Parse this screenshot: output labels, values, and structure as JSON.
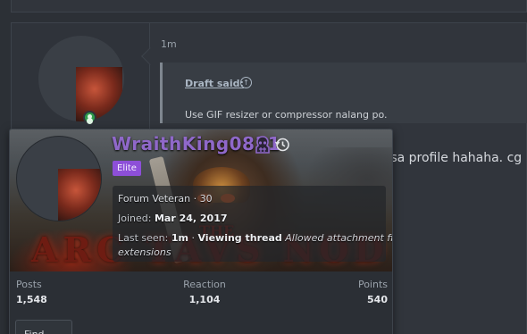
{
  "post": {
    "time": "1m",
    "quote_author": "Draft said:",
    "quote_arrow_icon": "arrow-up-icon",
    "quote_text": "Use GIF resizer or compressor nalang po.",
    "body_text": "n sa profile hahaha. cg"
  },
  "member_card": {
    "username": "WraithKing0831",
    "username_color": "#8f68c9",
    "staff_icon": "staff-badge-icon",
    "history_icon": "history-icon",
    "banner_label": "Elite",
    "banner_color": "#8d4fd8",
    "title_line": "Forum Veteran · 30",
    "joined_label": "Joined:",
    "joined_value": "Mar 24, 2017",
    "last_seen_label": "Last seen:",
    "last_seen_time": "1m",
    "last_seen_separator": " · ",
    "activity": "Viewing thread",
    "activity_detail_1": "Allowed attachment file",
    "activity_detail_2": "extensions",
    "stats": [
      {
        "label": "Posts",
        "value": "1,548"
      },
      {
        "label": "Reaction",
        "value": "1,104"
      },
      {
        "label": "Points",
        "value": "540"
      }
    ],
    "find_button": "Find"
  }
}
